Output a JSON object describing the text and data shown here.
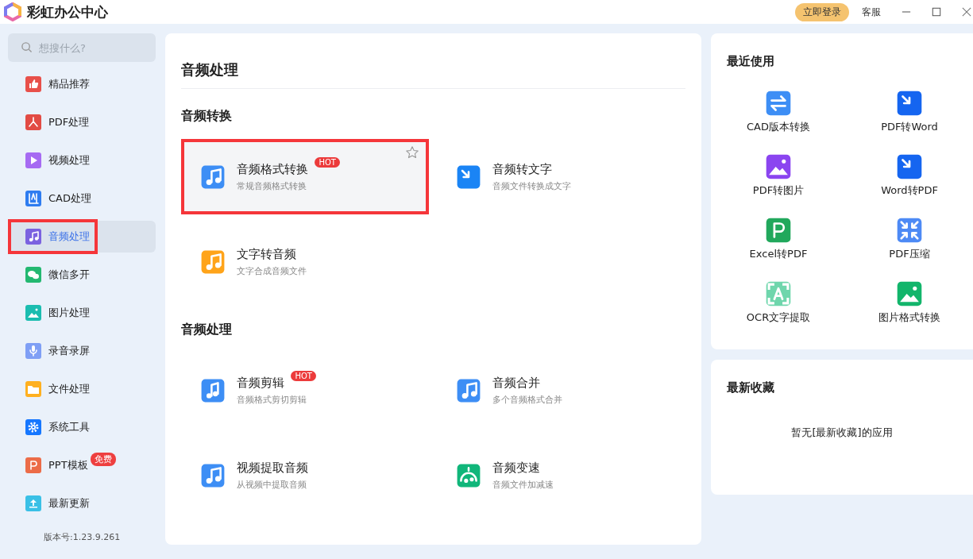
{
  "window": {
    "title": "彩虹办公中心",
    "login_button": "立即登录",
    "support_link": "客服"
  },
  "search": {
    "placeholder": "想搜什么?"
  },
  "sidebar": {
    "items": [
      {
        "label": "精品推荐",
        "selected": false,
        "highlighted": false
      },
      {
        "label": "PDF处理",
        "selected": false,
        "highlighted": false
      },
      {
        "label": "视频处理",
        "selected": false,
        "highlighted": false
      },
      {
        "label": "CAD处理",
        "selected": false,
        "highlighted": false
      },
      {
        "label": "音频处理",
        "selected": true,
        "highlighted": true
      },
      {
        "label": "微信多开",
        "selected": false,
        "highlighted": false
      },
      {
        "label": "图片处理",
        "selected": false,
        "highlighted": false
      },
      {
        "label": "录音录屏",
        "selected": false,
        "highlighted": false
      },
      {
        "label": "文件处理",
        "selected": false,
        "highlighted": false
      },
      {
        "label": "系统工具",
        "selected": false,
        "highlighted": false
      },
      {
        "label": "PPT模板",
        "selected": false,
        "highlighted": false,
        "badge": "免费"
      },
      {
        "label": "最新更新",
        "selected": false,
        "highlighted": false
      }
    ],
    "version": "版本号:1.23.9.261"
  },
  "main": {
    "title": "音频处理",
    "sections": [
      {
        "title": "音频转换",
        "tools": [
          {
            "title": "音频格式转换",
            "description": "常规音频格式转换",
            "badge": "HOT",
            "hovered": true,
            "highlighted": true
          },
          {
            "title": "音频转文字",
            "description": "音频文件转换成文字",
            "hovered": false,
            "highlighted": false
          },
          {
            "title": "文字转音频",
            "description": "文字合成音频文件",
            "hovered": false,
            "highlighted": false
          }
        ]
      },
      {
        "title": "音频处理",
        "tools": [
          {
            "title": "音频剪辑",
            "description": "音频格式剪切剪辑",
            "badge": "HOT",
            "hovered": false,
            "highlighted": false
          },
          {
            "title": "音频合并",
            "description": "多个音频格式合并",
            "hovered": false,
            "highlighted": false
          },
          {
            "title": "视频提取音频",
            "description": "从视频中提取音频",
            "hovered": false,
            "highlighted": false
          },
          {
            "title": "音频变速",
            "description": "音频文件加减速",
            "hovered": false,
            "highlighted": false
          }
        ]
      }
    ]
  },
  "recent": {
    "title": "最近使用",
    "items": [
      {
        "label": "CAD版本转换"
      },
      {
        "label": "PDF转Word"
      },
      {
        "label": "PDF转图片"
      },
      {
        "label": "Word转PDF"
      },
      {
        "label": "Excel转PDF"
      },
      {
        "label": "PDF压缩"
      },
      {
        "label": "OCR文字提取"
      },
      {
        "label": "图片格式转换"
      }
    ]
  },
  "favorites": {
    "title": "最新收藏",
    "empty_text": "暂无[最新收藏]的应用"
  }
}
